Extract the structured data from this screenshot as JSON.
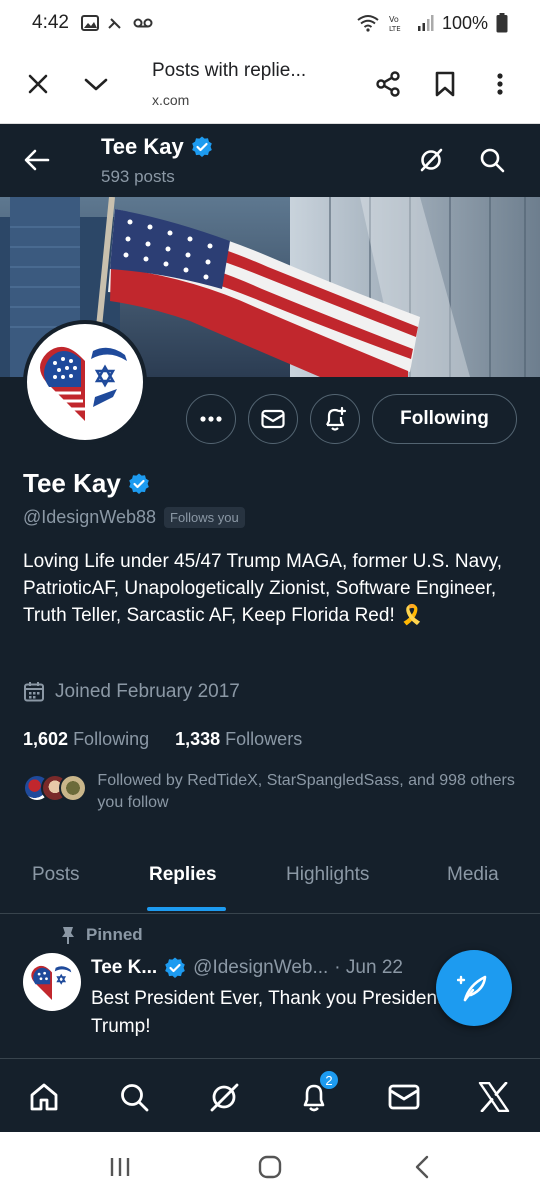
{
  "status_bar": {
    "time": "4:42",
    "battery": "100%"
  },
  "browser": {
    "title": "Posts with replie...",
    "url": "x.com"
  },
  "header": {
    "name": "Tee Kay",
    "posts": "593 posts"
  },
  "profile": {
    "name": "Tee Kay",
    "handle": "@IdesignWeb88",
    "follows_you": "Follows you",
    "following_button": "Following",
    "bio": "Loving Life under 45/47 Trump MAGA, former U.S. Navy, PatrioticAF, Unapologetically Zionist, Software Engineer, Truth Teller, Sarcastic AF, Keep Florida Red! 🎗️",
    "joined": "Joined February 2017",
    "following_count": "1,602",
    "following_label": "Following",
    "followers_count": "1,338",
    "followers_label": "Followers",
    "followed_by": "Followed by RedTideX, StarSpangledSass, and 998 others you follow"
  },
  "tabs": [
    {
      "label": "Posts"
    },
    {
      "label": "Replies"
    },
    {
      "label": "Highlights"
    },
    {
      "label": "Media"
    }
  ],
  "pinned_tweet": {
    "pinned_label": "Pinned",
    "name": "Tee K...",
    "handle": "@IdesignWeb...",
    "date": "· Jun 22",
    "text": "Best President Ever, Thank you President Trump!"
  },
  "bottom_nav": {
    "notification_count": "2"
  },
  "colors": {
    "background": "#15202b",
    "accent": "#1d9bf0",
    "muted": "#8b98a5"
  }
}
